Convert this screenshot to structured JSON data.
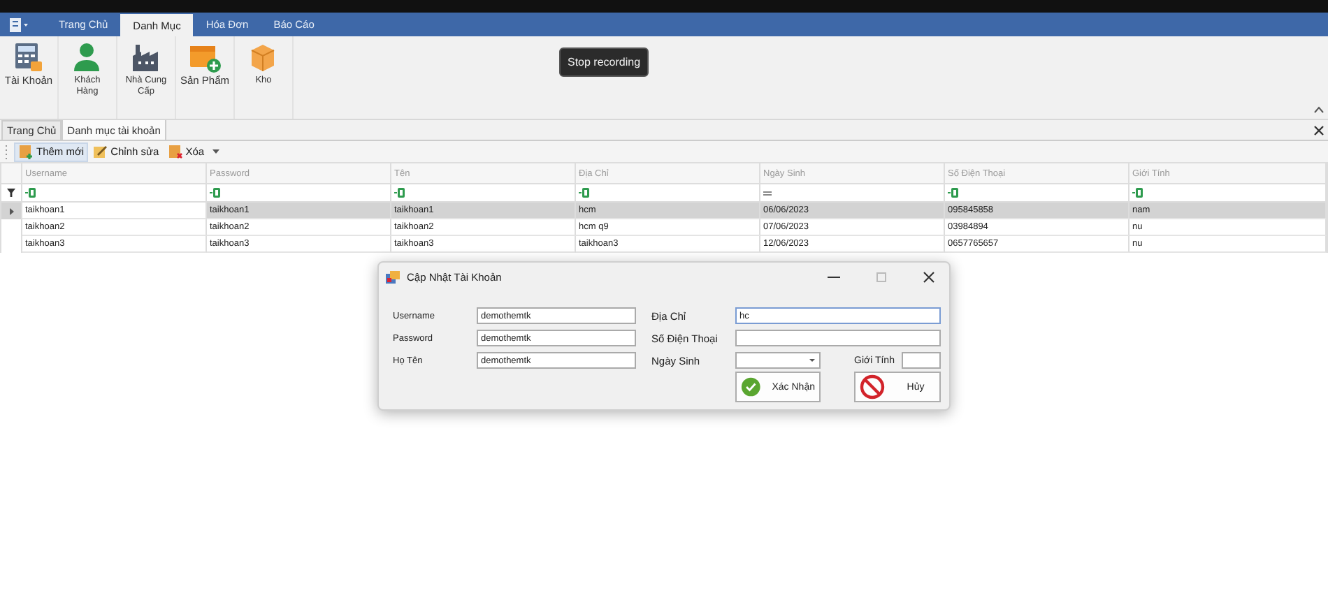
{
  "ribbon": {
    "tabs": [
      {
        "label": "Trang Chủ",
        "selected": false
      },
      {
        "label": "Danh Mục",
        "selected": true
      },
      {
        "label": "Hóa Đơn",
        "selected": false
      },
      {
        "label": "Báo Cáo",
        "selected": false
      }
    ],
    "buttons": [
      {
        "label": "Tài Khoản",
        "kind": "account"
      },
      {
        "label": "Khách Hàng",
        "kind": "person"
      },
      {
        "label": "Nhà Cung Cấp",
        "kind": "factory"
      },
      {
        "label": "Sản Phẩm",
        "kind": "product"
      },
      {
        "label": "Kho",
        "kind": "box"
      }
    ]
  },
  "tooltip": {
    "text": "Stop recording"
  },
  "document_tabs": [
    {
      "label": "Trang Chủ",
      "selected": false
    },
    {
      "label": "Danh mục tài khoản",
      "selected": true
    }
  ],
  "toolbar": [
    {
      "label": "Thêm mới",
      "kind": "add",
      "selected": true,
      "dropdown": false
    },
    {
      "label": "Chỉnh sửa",
      "kind": "edit",
      "selected": false,
      "dropdown": false
    },
    {
      "label": "Xóa",
      "kind": "delete",
      "selected": false,
      "dropdown": true
    }
  ],
  "grid": {
    "columns": [
      {
        "label": "Username",
        "kind": "text"
      },
      {
        "label": "Password",
        "kind": "text"
      },
      {
        "label": "Tên",
        "kind": "text"
      },
      {
        "label": "Địa Chỉ",
        "kind": "text"
      },
      {
        "label": "Ngày Sinh",
        "kind": "date"
      },
      {
        "label": "Số Điện Thoại",
        "kind": "text"
      },
      {
        "label": "Giới Tính",
        "kind": "text"
      }
    ],
    "rows": [
      {
        "selected": true,
        "cells": [
          "taikhoan1",
          "taikhoan1",
          "taikhoan1",
          "hcm",
          "06/06/2023",
          "095845858",
          "nam"
        ]
      },
      {
        "selected": false,
        "cells": [
          "taikhoan2",
          "taikhoan2",
          "taikhoan2",
          "hcm q9",
          "07/06/2023",
          "03984894",
          "nu"
        ]
      },
      {
        "selected": false,
        "cells": [
          "taikhoan3",
          "taikhoan3",
          "taikhoan3",
          "taikhoan3",
          "12/06/2023",
          "0657765657",
          "nu"
        ]
      }
    ]
  },
  "dialog": {
    "title": "Cập Nhật Tài Khoản",
    "left_fields": [
      {
        "label": "Username",
        "value": "demothemtk"
      },
      {
        "label": "Password",
        "value": "demothemtk"
      },
      {
        "label": "Họ Tên",
        "value": "demothemtk"
      }
    ],
    "address": {
      "label": "Địa Chỉ",
      "value": "hc",
      "focused": true
    },
    "phone": {
      "label": "Số Điện Thoại"
    },
    "birthday": {
      "label": "Ngày Sinh"
    },
    "gender": {
      "label": "Giới Tính"
    },
    "buttons": [
      {
        "label": "Xác Nhận",
        "kind": "confirm"
      },
      {
        "label": "Hủy",
        "kind": "cancel"
      }
    ]
  }
}
